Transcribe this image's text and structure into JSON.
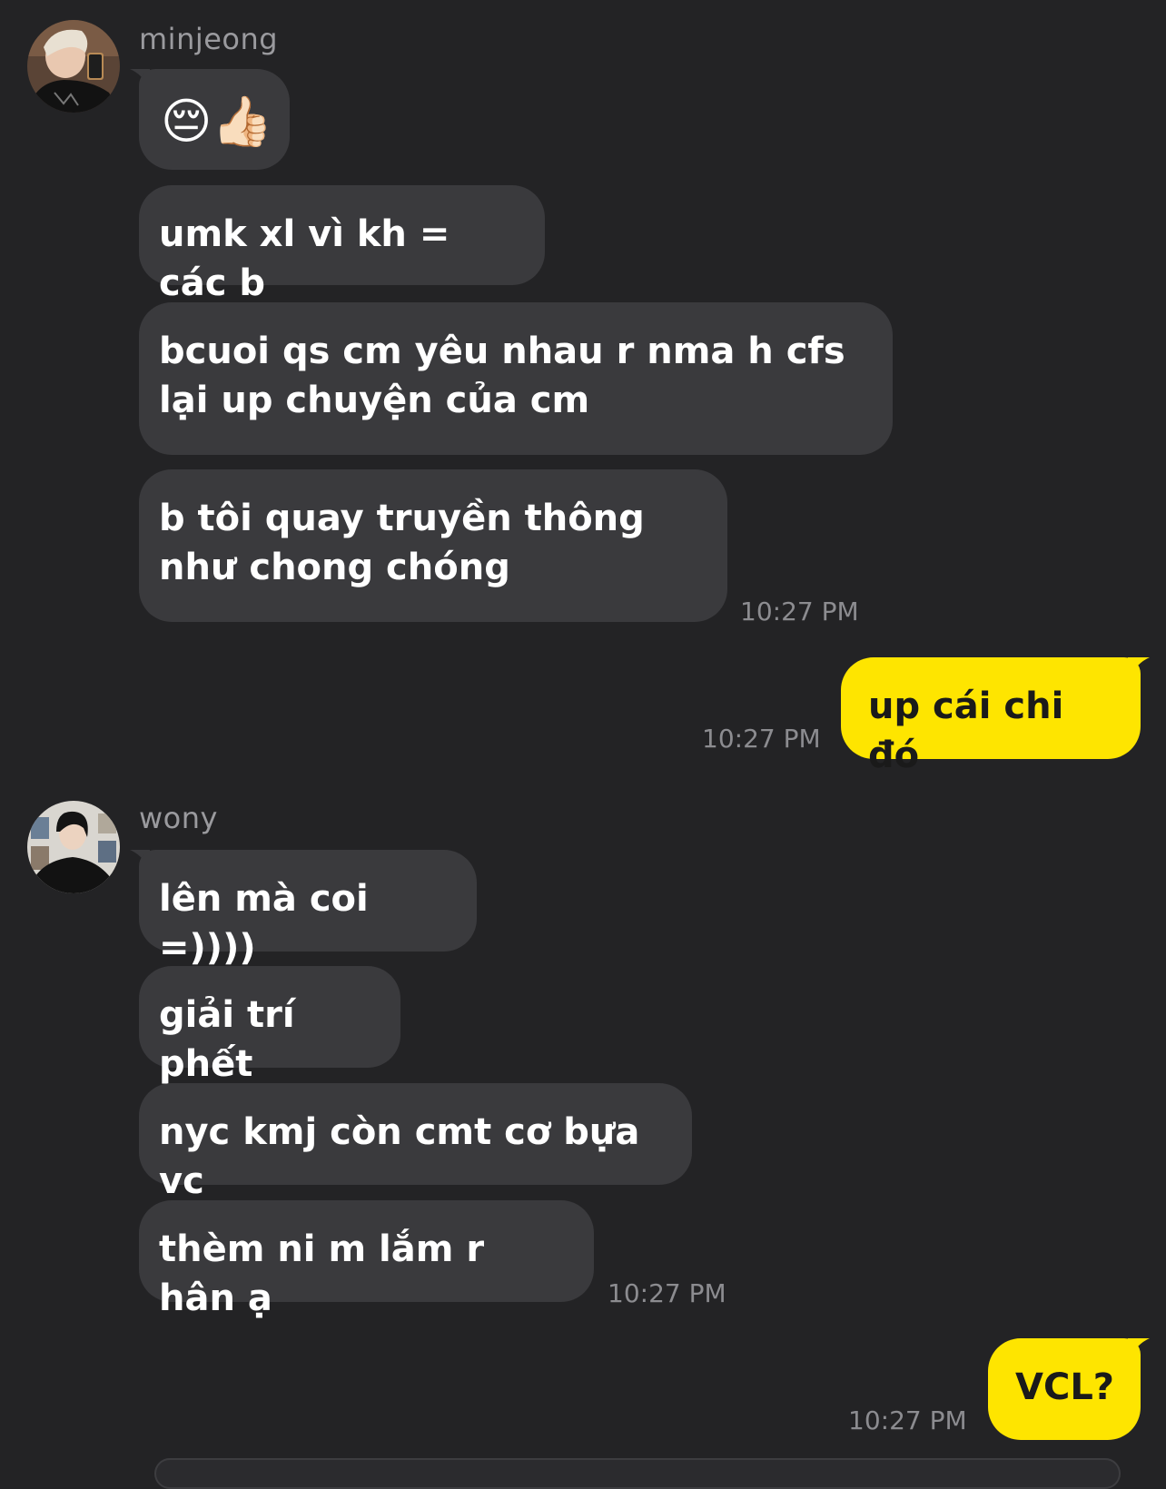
{
  "chat": {
    "groups": [
      {
        "sender": "minjeong",
        "avatar_icon": "minjeong-profile-avatar",
        "messages": [
          "😔👍🏻",
          "umk xl vì kh = các b",
          "bcuoi qs cm yêu nhau r nma h cfs lại up chuyện của cm",
          "b tôi quay truyền thông như chong chóng"
        ],
        "time": "10:27 PM"
      },
      {
        "sender": "me",
        "messages": [
          "up cái chi đó"
        ],
        "time": "10:27 PM"
      },
      {
        "sender": "wony",
        "avatar_icon": "wony-profile-avatar",
        "messages": [
          "lên mà coi =))))",
          "giải trí phết",
          "nyc kmj còn cmt cơ bựa vc",
          "thèm ni m lắm r hân ạ"
        ],
        "time": "10:27 PM"
      },
      {
        "sender": "me",
        "messages": [
          "VCL?"
        ],
        "time": "10:27 PM"
      }
    ]
  },
  "colors": {
    "background": "#232325",
    "incoming_bubble": "#3a3a3d",
    "outgoing_bubble": "#fee500",
    "sender_name": "#9a9a9e",
    "timestamp": "#8c8c90"
  }
}
